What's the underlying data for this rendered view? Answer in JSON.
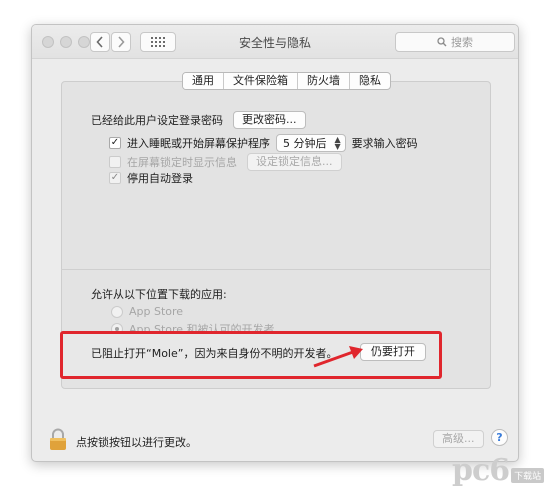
{
  "window": {
    "title": "安全性与隐私",
    "search_placeholder": "搜索"
  },
  "tabs": [
    {
      "label": "通用",
      "selected": true
    },
    {
      "label": "文件保险箱",
      "selected": false
    },
    {
      "label": "防火墙",
      "selected": false
    },
    {
      "label": "隐私",
      "selected": false
    }
  ],
  "general": {
    "password_set_text": "已经给此用户设定登录密码",
    "change_password_button": "更改密码...",
    "require_password": {
      "label": "进入睡眠或开始屏幕保护程序",
      "checked": true,
      "delay_value": "5 分钟后",
      "suffix": "要求输入密码"
    },
    "lock_message": {
      "label": "在屏幕锁定时显示信息",
      "checked": false,
      "button": "设定锁定信息..."
    },
    "disable_auto_login": {
      "label": "停用自动登录",
      "checked": true
    }
  },
  "downloads": {
    "heading": "允许从以下位置下载的应用:",
    "options": [
      {
        "label": "App Store",
        "selected": false
      },
      {
        "label": "App Store 和被认可的开发者",
        "selected": true
      }
    ]
  },
  "blocked": {
    "message": "已阻止打开“Mole”，因为来自身份不明的开发者。",
    "open_anyway_button": "仍要打开"
  },
  "footer": {
    "lock_text": "点按锁按钮以进行更改。",
    "advanced_button": "高级...",
    "help_label": "?"
  },
  "watermark": {
    "logo": "pc6",
    "badge": "下载站"
  },
  "colors": {
    "highlight_red": "#e0262d",
    "lock_gold": "#e0a23a"
  }
}
